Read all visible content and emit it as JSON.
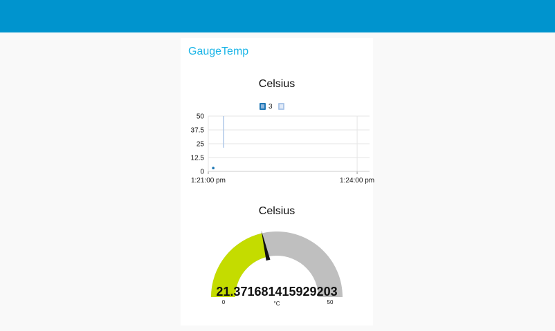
{
  "colors": {
    "header": "#0094ce",
    "group_title": "#1bb5e7",
    "gauge_fill": "#c4dc00",
    "gauge_track": "#bfbfbf",
    "series_line": "#aec7e8",
    "series_point": "#1f77b4"
  },
  "group": {
    "title": "GaugeTemp"
  },
  "chart": {
    "title": "Celsius",
    "legend": [
      {
        "label": "3"
      },
      {
        "label": ""
      }
    ]
  },
  "chart_data": [
    {
      "type": "line",
      "title": "Celsius",
      "y_ticks": [
        "50",
        "37.5",
        "25",
        "12.5",
        "0"
      ],
      "x_ticks": [
        "1:21:00 pm",
        "1:24:00 pm"
      ],
      "ylim": [
        0,
        50
      ],
      "xlim_minutes_from_tick_1": [
        0,
        3.25
      ],
      "grid": true,
      "legend_position": "top-center",
      "series": [
        {
          "name": "3",
          "points": [
            {
              "x_minutes": 0.1,
              "y": 3
            }
          ]
        },
        {
          "name": "",
          "points": [
            {
              "x_minutes": 0.31,
              "y": 21.37
            },
            {
              "x_minutes": 0.31,
              "y": 50
            }
          ]
        }
      ]
    },
    {
      "type": "gauge",
      "title": "Celsius",
      "value": 21.371681415929203,
      "value_label": "21.371681415929203",
      "min": 0,
      "max": 50,
      "min_label": "0",
      "max_label": "50",
      "units": "°C"
    }
  ]
}
